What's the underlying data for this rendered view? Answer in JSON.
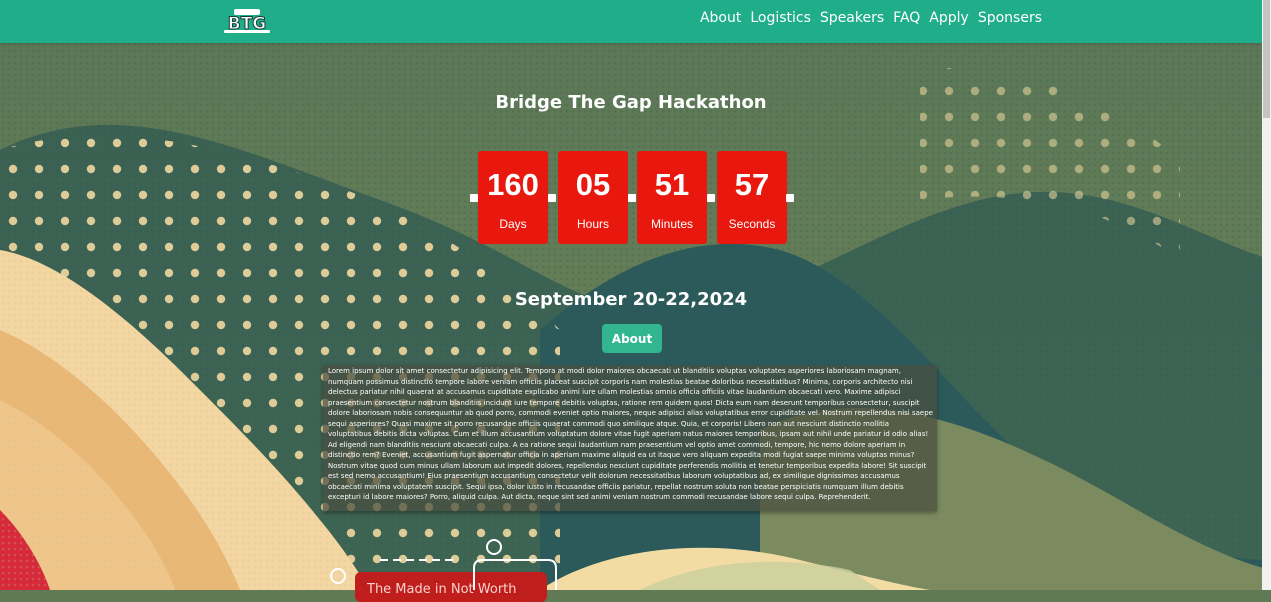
{
  "nav": {
    "logo_alt": "BTG",
    "links": [
      "About",
      "Logistics",
      "Speakers",
      "FAQ",
      "Apply",
      "Sponsers"
    ]
  },
  "hero": {
    "title": "Bridge The Gap Hackathon",
    "countdown": [
      {
        "value": "160",
        "label": "Days"
      },
      {
        "value": "05",
        "label": "Hours"
      },
      {
        "value": "51",
        "label": "Minutes"
      },
      {
        "value": "57",
        "label": "Seconds"
      }
    ],
    "date": "September 20-22,2024",
    "about_button": "About",
    "about_text": "Lorem ipsum dolor sit amet consectetur adipisicing elit. Tempora at modi dolor maiores obcaecati ut blanditiis voluptas voluptates asperiores laboriosam magnam, numquam possimus distinctio tempore labore veniam officiis placeat suscipit corporis nam molestias beatae doloribus necessitatibus? Minima, corporis architecto nisi delectus pariatur nihil quaerat at accusamus cupiditate explicabo animi iure ullam molestias omnis officia officiis vitae laudantium obcaecati vero. Maxime adipisci praesentium consectetur nostrum blanditiis incidunt iure tempore debitis voluptas, ratione rem quidem quos! Dicta eum nam deserunt temporibus consectetur, suscipit dolore laboriosam nobis consequuntur ab quod porro, commodi eveniet optio maiores, neque adipisci alias voluptatibus error cupiditate vel. Nostrum repellendus nisi saepe sequi asperiores? Quasi maxime sit porro recusandae officiis quaerat commodi quo similique atque. Quia, et corporis! Libero non aut nesciunt distinctio mollitia voluptatibus debitis dicta voluptas. Cum et illum accusantium voluptatum dolore vitae fugit aperiam natus maiores temporibus, ipsam aut nihil unde pariatur id odio alias! Ad eligendi nam blanditiis nesciunt obcaecati culpa. A ea ratione sequi laudantium nam praesentium vel optio amet commodi, tempore, hic nemo dolore aperiam in distinctio rem? Eveniet, accusantium fugit aspernatur officia in aperiam maxime aliquid ea ut itaque vero aliquam expedita modi fugiat saepe minima voluptas minus? Nostrum vitae quod cum minus ullam laborum aut impedit dolores, repellendus nesciunt cupiditate perferendis mollitia et tenetur temporibus expedita labore! Sit suscipit est sed nemo accusantium! Eius praesentium accusantium consectetur velit dolorum necessitatibus laborum voluptatibus ad, ex similique dignissimos accusamus obcaecati minima voluptatem suscipit. Sequi ipsa, dolor iusto in recusandae officiis pariatur, repellat nostrum soluta non beatae perspiciatis numquam illum debitis excepturi id labore maiores? Porro, aliquid culpa. Aut dicta, neque sint sed animi veniam nostrum commodi recusandae labore sequi culpa. Reprehenderit."
  },
  "timeline": {
    "first_card_title": "The Made in Not Worth"
  },
  "colors": {
    "navbar": "#1fae89",
    "countdown_box": "#e8180f",
    "about_button": "#32b68f"
  }
}
